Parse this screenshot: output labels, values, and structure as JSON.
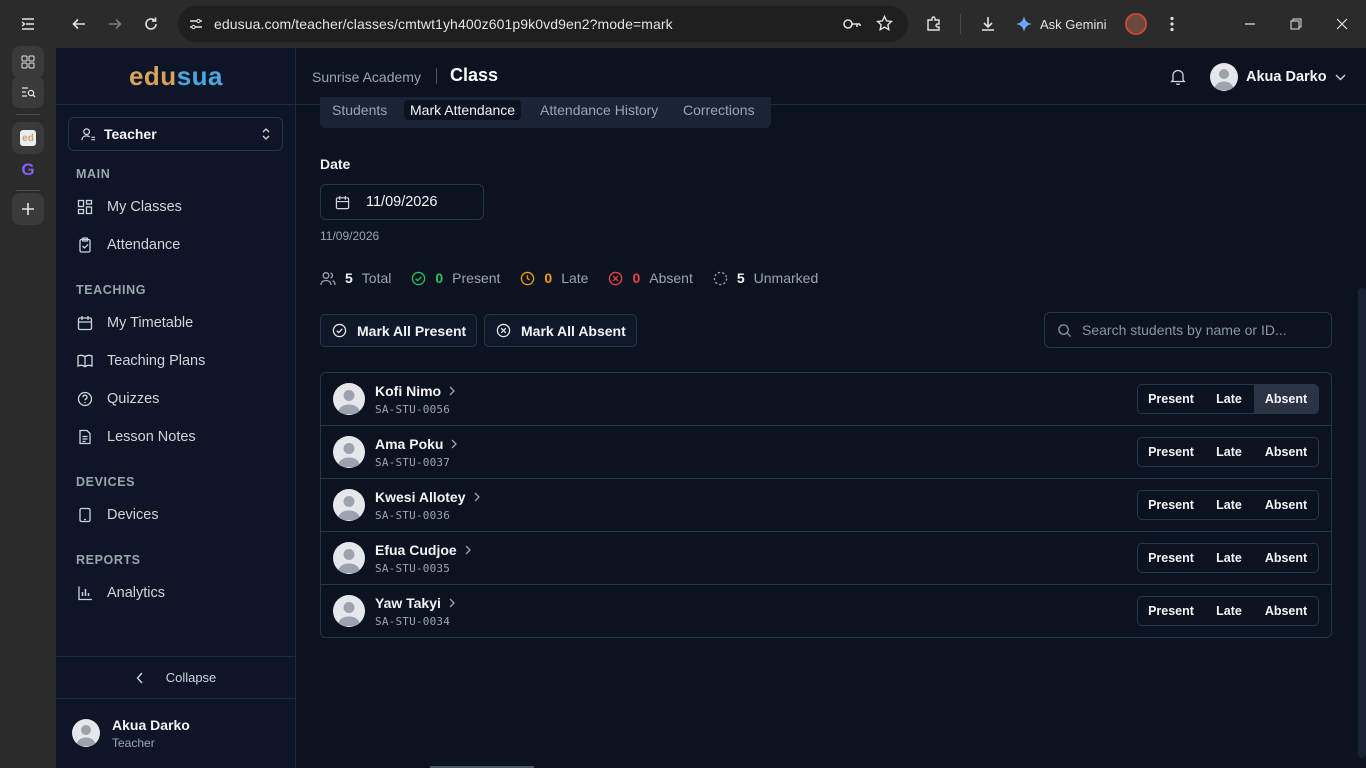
{
  "browser": {
    "url": "edusua.com/teacher/classes/cmtwt1yh400z601p9k0vd9en2?mode=mark",
    "gemini_label": "Ask Gemini"
  },
  "app": {
    "logo_part1": "edu",
    "logo_part2": "sua",
    "role": "Teacher",
    "sections": [
      {
        "title": "MAIN",
        "items": [
          "My Classes",
          "Attendance"
        ]
      },
      {
        "title": "TEACHING",
        "items": [
          "My Timetable",
          "Teaching Plans",
          "Quizzes",
          "Lesson Notes"
        ]
      },
      {
        "title": "DEVICES",
        "items": [
          "Devices"
        ]
      },
      {
        "title": "REPORTS",
        "items": [
          "Analytics"
        ]
      }
    ],
    "collapse_label": "Collapse",
    "footer_user": {
      "name": "Akua Darko",
      "role": "Teacher"
    }
  },
  "header": {
    "school": "Sunrise Academy",
    "title": "Class",
    "user_name": "Akua Darko"
  },
  "tabs": [
    "Students",
    "Mark Attendance",
    "Attendance History",
    "Corrections"
  ],
  "active_tab": "Mark Attendance",
  "date": {
    "label": "Date",
    "value": "11/09/2026",
    "sub": "11/09/2026"
  },
  "stats": {
    "total": {
      "n": "5",
      "label": "Total"
    },
    "present": {
      "n": "0",
      "label": "Present"
    },
    "late": {
      "n": "0",
      "label": "Late"
    },
    "absent": {
      "n": "0",
      "label": "Absent"
    },
    "unmarked": {
      "n": "5",
      "label": "Unmarked"
    }
  },
  "actions": {
    "mark_all_present": "Mark All Present",
    "mark_all_absent": "Mark All Absent",
    "search_placeholder": "Search students by name or ID..."
  },
  "status_labels": {
    "present": "Present",
    "late": "Late",
    "absent": "Absent"
  },
  "students": [
    {
      "name": "Kofi Nimo",
      "id": "SA-STU-0056",
      "selected": "absent"
    },
    {
      "name": "Ama Poku",
      "id": "SA-STU-0037",
      "selected": ""
    },
    {
      "name": "Kwesi Allotey",
      "id": "SA-STU-0036",
      "selected": ""
    },
    {
      "name": "Efua Cudjoe",
      "id": "SA-STU-0035",
      "selected": ""
    },
    {
      "name": "Yaw Takyi",
      "id": "SA-STU-0034",
      "selected": ""
    }
  ],
  "colors": {
    "present": "#22c55e",
    "late": "#f59e0b",
    "absent": "#ef4444",
    "unmarked": "#9aa4b2"
  }
}
